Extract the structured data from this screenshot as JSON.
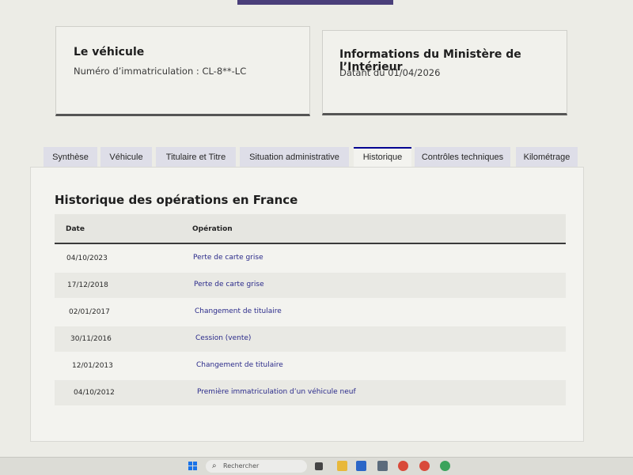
{
  "vehicle_card": {
    "title": "Le véhicule",
    "registration": "Numéro d’immatriculation : CL-8**-LC"
  },
  "ministry_card": {
    "title": "Informations du Ministère de l’Intérieur",
    "date": "Datant du 01/04/2026"
  },
  "tabs": [
    {
      "label": "Synthèse",
      "active": false
    },
    {
      "label": "Véhicule",
      "active": false
    },
    {
      "label": "Titulaire et Titre",
      "active": false
    },
    {
      "label": "Situation administrative",
      "active": false
    },
    {
      "label": "Historique",
      "active": true
    },
    {
      "label": "Contrôles techniques",
      "active": false
    },
    {
      "label": "Kilométrage",
      "active": false
    }
  ],
  "history": {
    "title": "Historique des opérations en France",
    "columns": {
      "date": "Date",
      "operation": "Opération"
    },
    "rows": [
      {
        "date": "04/10/2023",
        "operation": "Perte de carte grise"
      },
      {
        "date": "17/12/2018",
        "operation": "Perte de carte grise"
      },
      {
        "date": "02/01/2017",
        "operation": "Changement de titulaire"
      },
      {
        "date": "30/11/2016",
        "operation": "Cession (vente)"
      },
      {
        "date": "12/01/2013",
        "operation": "Changement de titulaire"
      },
      {
        "date": "04/10/2012",
        "operation": "Première immatriculation d’un véhicule neuf"
      }
    ]
  },
  "taskbar": {
    "search_placeholder": "Rechercher",
    "icons": [
      "windows-icon",
      "search-icon",
      "task-view-icon",
      "file-explorer-icon",
      "store-icon",
      "calculator-icon",
      "chrome-icon",
      "chrome-icon",
      "chrome-icon"
    ]
  },
  "colors": {
    "accent": "#000091",
    "link": "#2a2a8a",
    "top_bar": "#4a3f7a"
  }
}
